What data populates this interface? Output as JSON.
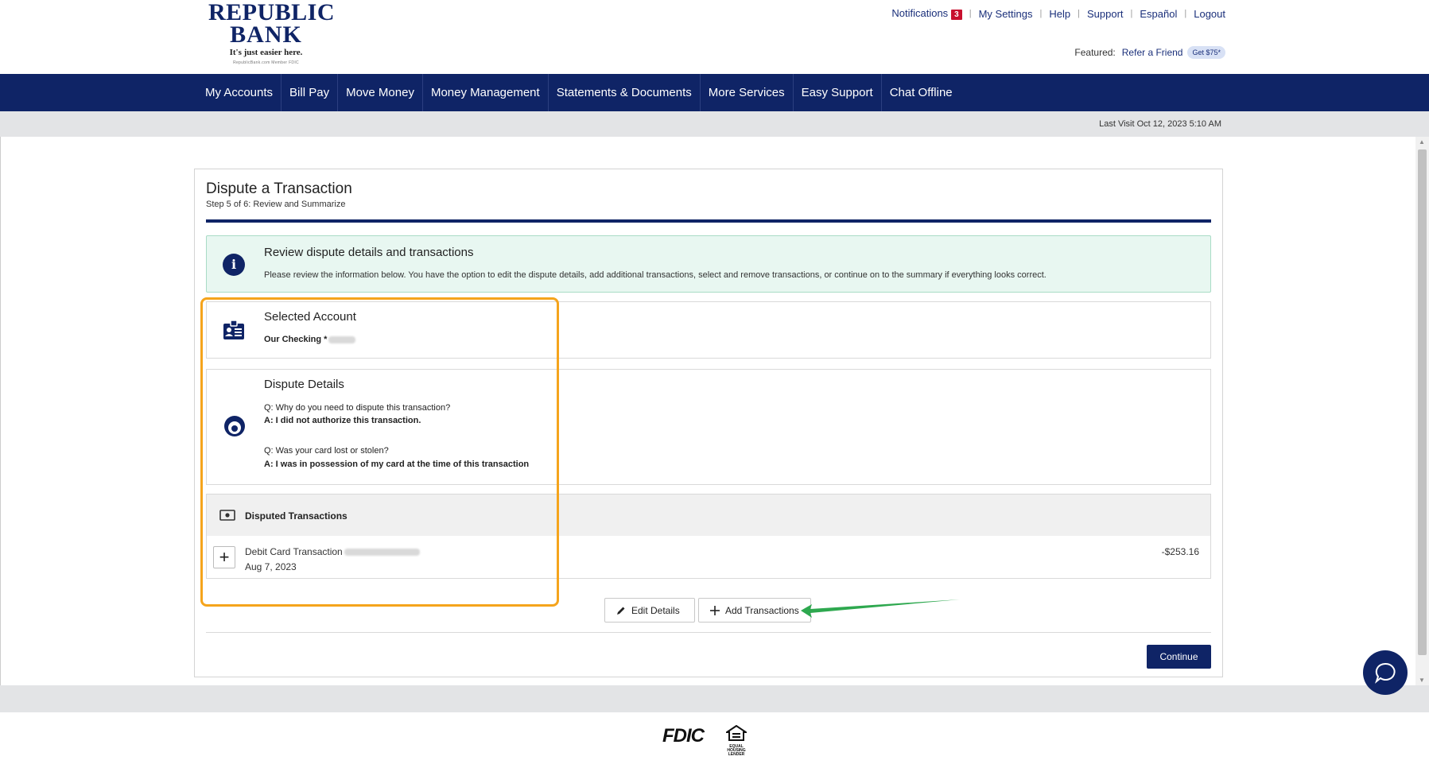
{
  "header": {
    "logo": {
      "line1": "REPUBLIC",
      "line2": "BANK",
      "tagline": "It's just easier here.",
      "fine_print": "RepublicBank.com      Member FDIC"
    },
    "top_links": {
      "notifications": "Notifications",
      "notifications_count": "3",
      "settings": "My Settings",
      "help": "Help",
      "support": "Support",
      "espanol": "Español",
      "logout": "Logout"
    },
    "featured": {
      "label": "Featured:",
      "link": "Refer a Friend",
      "badge": "Get $75*"
    }
  },
  "nav": {
    "items": [
      "My Accounts",
      "Bill Pay",
      "Move Money",
      "Money Management",
      "Statements & Documents",
      "More Services",
      "Easy Support",
      "Chat Offline"
    ]
  },
  "last_visit": "Last Visit Oct 12, 2023 5:10 AM",
  "page": {
    "title": "Dispute a Transaction",
    "step": "Step 5 of 6: Review and Summarize",
    "info": {
      "heading": "Review dispute details and transactions",
      "text": "Please review the information below. You have the option to edit the dispute details, add additional transactions, select and remove transactions, or continue on to the summary if everything looks correct."
    },
    "account": {
      "heading": "Selected Account",
      "name": "Our Checking *"
    },
    "details": {
      "heading": "Dispute Details",
      "q1": "Q: Why do you need to dispute this transaction?",
      "a1": "A: I did not authorize this transaction.",
      "q2": "Q: Was your card lost or stolen?",
      "a2": "A: I was in possession of my card at the time of this transaction"
    },
    "disputed": {
      "heading": "Disputed Transactions",
      "transaction": {
        "name": "Debit Card Transaction",
        "date": "Aug 7, 2023",
        "amount": "-$253.16"
      }
    },
    "buttons": {
      "edit": "Edit Details",
      "add": "Add Transactions",
      "continue": "Continue"
    }
  },
  "footer": {
    "fdic": "FDIC",
    "ehl": "EQUAL HOUSING LENDER"
  },
  "colors": {
    "brand": "#0f2466",
    "highlight": "#f5a41c",
    "arrow": "#2ea84f",
    "info_bg": "#e8f7f1"
  }
}
